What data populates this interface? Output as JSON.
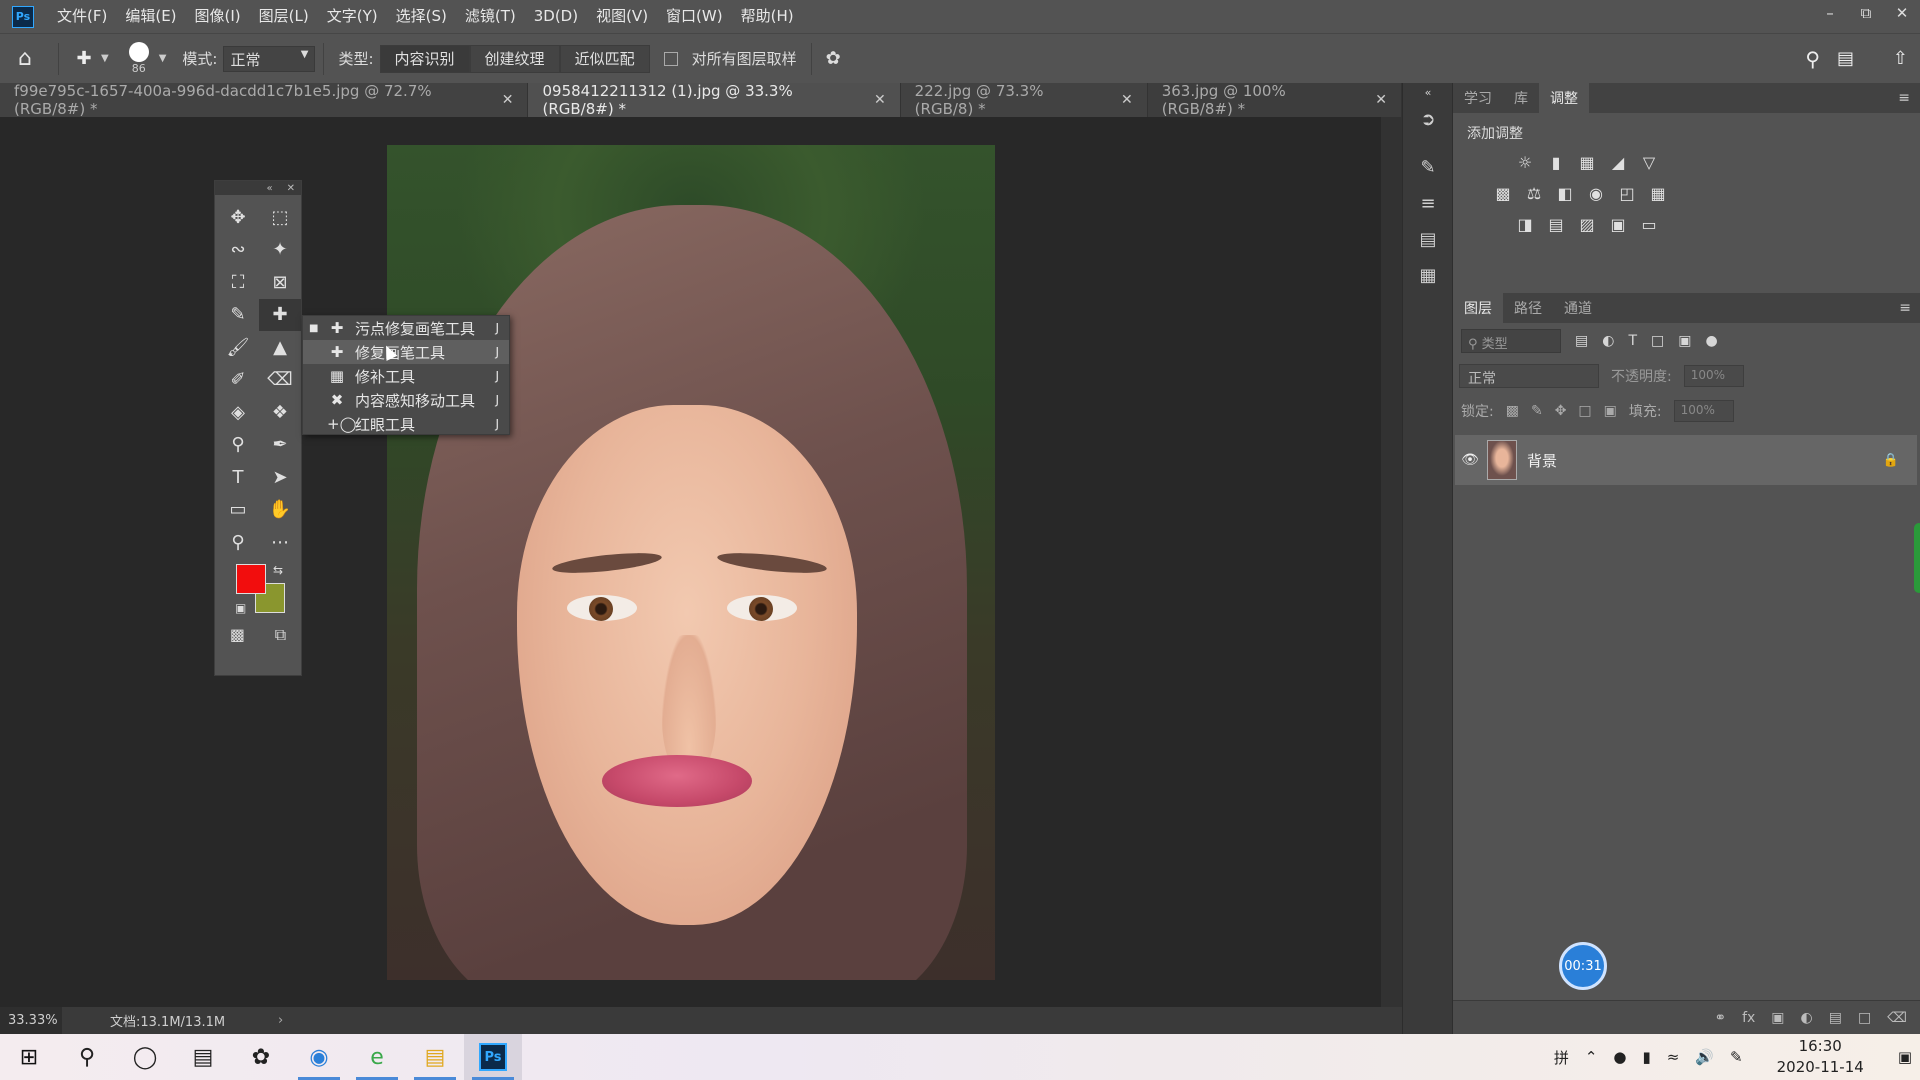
{
  "app": {
    "logo": "Ps"
  },
  "menu": [
    "文件(F)",
    "编辑(E)",
    "图像(I)",
    "图层(L)",
    "文字(Y)",
    "选择(S)",
    "滤镜(T)",
    "3D(D)",
    "视图(V)",
    "窗口(W)",
    "帮助(H)"
  ],
  "options": {
    "brush_size": "86",
    "mode_label": "模式:",
    "mode_value": "正常",
    "type_label": "类型:",
    "type_buttons": [
      "内容识别",
      "创建纹理",
      "近似匹配"
    ],
    "sample_all_label": "对所有图层取样"
  },
  "tabs": [
    {
      "title": "f99e795c-1657-400a-996d-dacdd1c7b1e5.jpg @ 72.7%(RGB/8#) *"
    },
    {
      "title": "0958412211312 (1).jpg @ 33.3%(RGB/8#) *"
    },
    {
      "title": "222.jpg @ 73.3%(RGB/8) *"
    },
    {
      "title": "363.jpg @ 100%(RGB/8#) *"
    }
  ],
  "flyout": [
    {
      "label": "污点修复画笔工具",
      "key": "J"
    },
    {
      "label": "修复画笔工具",
      "key": "J"
    },
    {
      "label": "修补工具",
      "key": "J"
    },
    {
      "label": "内容感知移动工具",
      "key": "J"
    },
    {
      "label": "红眼工具",
      "key": "J"
    }
  ],
  "colors": {
    "foreground": "#f20d0d",
    "background": "#8a962e",
    "accent": "#31a8ff"
  },
  "status": {
    "zoom": "33.33%",
    "doc_info": "文档:13.1M/13.1M"
  },
  "adjustments_panel": {
    "tabs": [
      "学习",
      "库",
      "调整"
    ],
    "title": "添加调整"
  },
  "layers_panel": {
    "tabs": [
      "图层",
      "路径",
      "通道"
    ],
    "filter_placeholder": "类型",
    "blend_mode": "正常",
    "opacity_label": "不透明度:",
    "opacity_value": "100%",
    "lock_label": "锁定:",
    "fill_label": "填充:",
    "fill_value": "100%",
    "layers": [
      {
        "name": "背景"
      }
    ]
  },
  "timer": "00:31",
  "taskbar": {
    "ime": "拼",
    "time": "16:30",
    "date": "2020-11-14"
  }
}
